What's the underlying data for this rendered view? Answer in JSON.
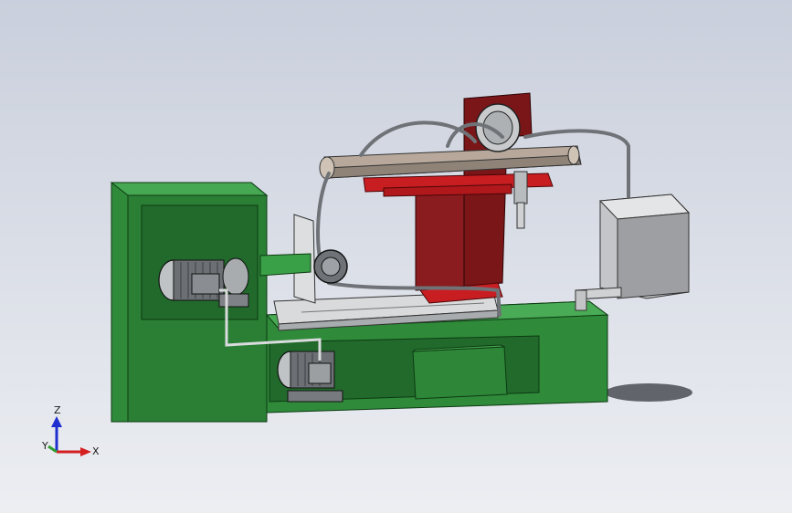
{
  "viewport": {
    "triad": {
      "x_label": "X",
      "y_label": "Y",
      "z_label": "Z",
      "x_color": "#d42020",
      "y_color": "#2fa02f",
      "z_color": "#2030d0"
    },
    "colors": {
      "frame": "#2f8a3a",
      "frame_dark": "#1f6a2a",
      "column": "#7a1518",
      "carriage": "#c81e22",
      "metal": "#b9bcbf",
      "tank": "#d7d8da"
    }
  }
}
